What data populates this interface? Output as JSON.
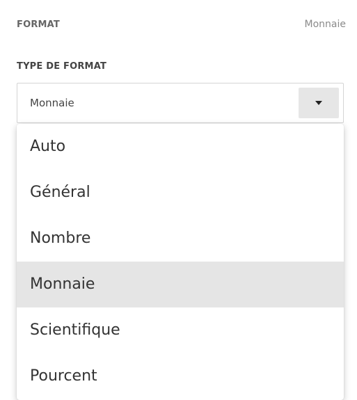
{
  "section": {
    "title": "FORMAT",
    "value": "Monnaie"
  },
  "field": {
    "label": "TYPE DE FORMAT",
    "selected": "Monnaie"
  },
  "dropdown": {
    "options": [
      {
        "label": "Auto"
      },
      {
        "label": "Général"
      },
      {
        "label": "Nombre"
      },
      {
        "label": "Monnaie"
      },
      {
        "label": "Scientifique"
      },
      {
        "label": "Pourcent"
      }
    ]
  },
  "icons": {
    "dropdown_arrow": "caret-down-icon"
  }
}
